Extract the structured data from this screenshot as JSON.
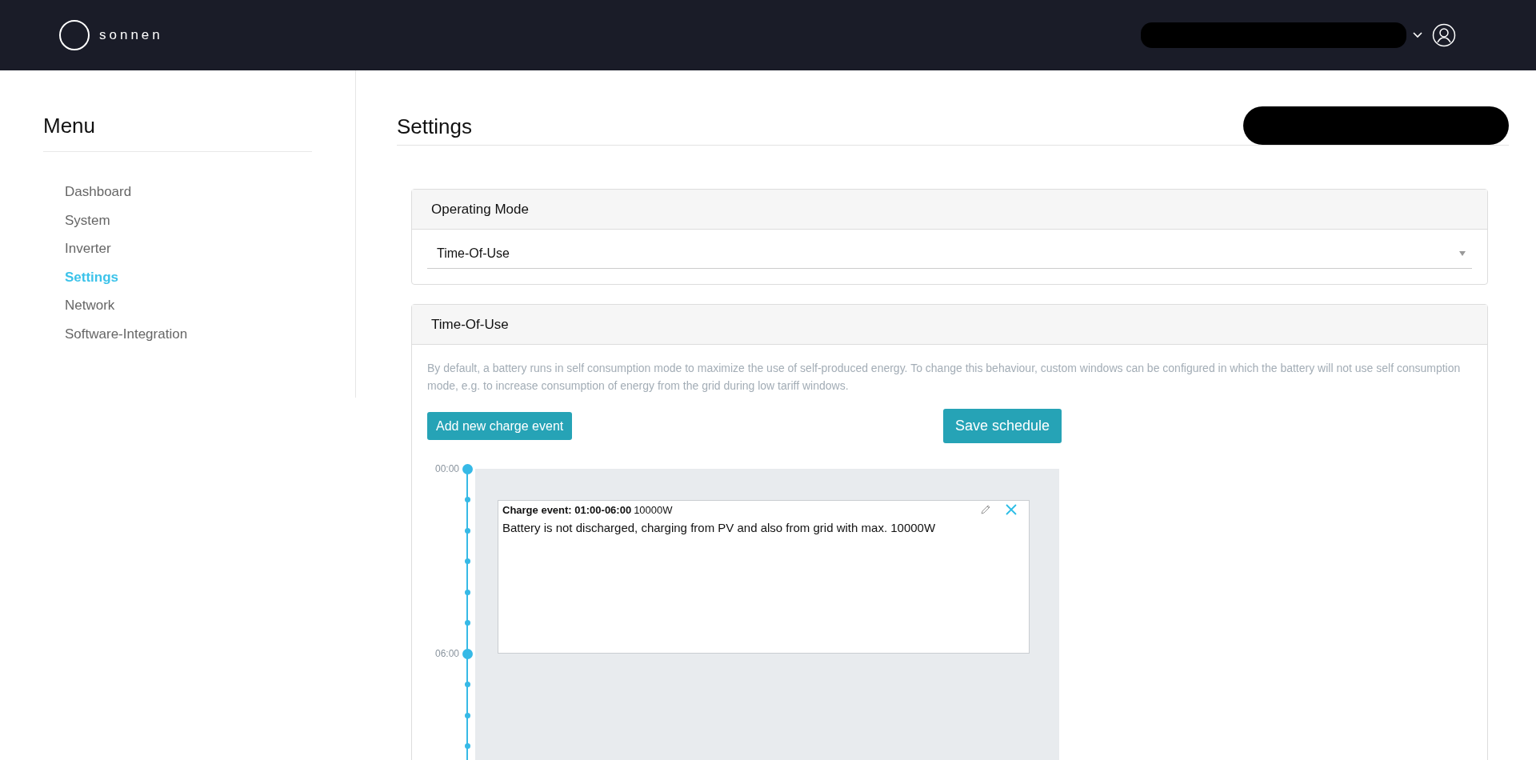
{
  "header": {
    "logo_text": "sonnen"
  },
  "menu": {
    "title": "Menu",
    "items": [
      {
        "label": "Dashboard",
        "selected": false
      },
      {
        "label": "System",
        "selected": false
      },
      {
        "label": "Inverter",
        "selected": false
      },
      {
        "label": "Settings",
        "selected": true
      },
      {
        "label": "Network",
        "selected": false
      },
      {
        "label": "Software-Integration",
        "selected": false
      }
    ]
  },
  "page": {
    "title": "Settings"
  },
  "operating_mode": {
    "title": "Operating Mode",
    "value": "Time-Of-Use"
  },
  "time_of_use": {
    "title": "Time-Of-Use",
    "description": "By default, a battery runs in self consumption mode to maximize the use of self-produced energy. To change this behaviour, custom windows can be configured in which the battery will not use self consumption mode, e.g. to increase consumption of energy from the grid during low tariff windows.",
    "add_button": "Add new charge event",
    "save_button": "Save schedule",
    "timeline": {
      "labels": [
        "00:00",
        "06:00"
      ],
      "events": [
        {
          "title": "Charge event: 01:00-06:00",
          "power": "10000W",
          "text": "Battery is not discharged, charging from PV and also from grid with max. 10000W"
        }
      ]
    }
  }
}
